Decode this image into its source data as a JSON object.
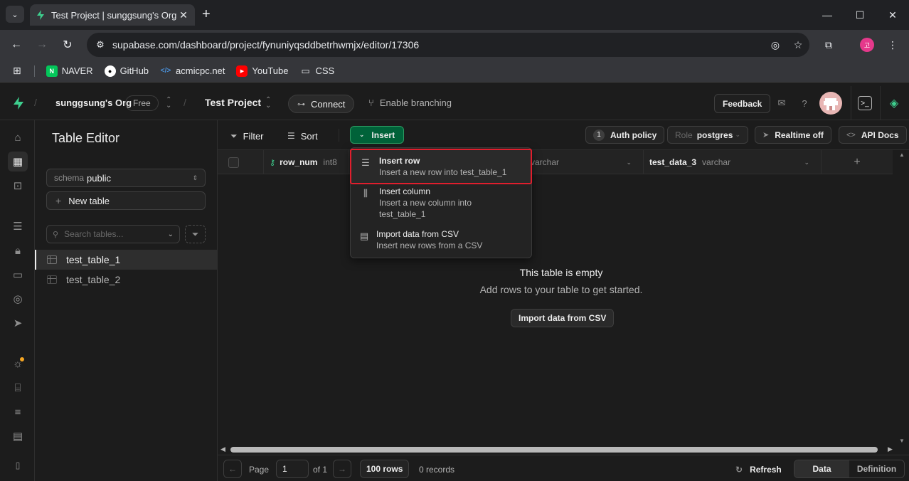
{
  "browser": {
    "tab_title": "Test Project | sunggsung's Org",
    "url": "supabase.com/dashboard/project/fynuniyqsddbetrhwmjx/editor/17306",
    "profile_initial": "고",
    "bookmarks": [
      "NAVER",
      "GitHub",
      "acmicpc.net",
      "YouTube",
      "CSS"
    ]
  },
  "appbar": {
    "org": "sunggsung's Org",
    "plan": "Free",
    "project": "Test Project",
    "connect": "Connect",
    "branching": "Enable branching",
    "feedback": "Feedback"
  },
  "sidebar": {
    "title": "Table Editor",
    "schema_label": "schema",
    "schema_value": "public",
    "new_table": "New table",
    "search_placeholder": "Search tables...",
    "tables": [
      "test_table_1",
      "test_table_2"
    ]
  },
  "toolbar": {
    "filter": "Filter",
    "sort": "Sort",
    "insert": "Insert",
    "auth_count": "1",
    "auth_policy": "Auth policy",
    "role_label": "Role",
    "role_value": "postgres",
    "realtime": "Realtime off",
    "api_docs": "API Docs"
  },
  "columns": [
    {
      "name": "row_num",
      "type": "int8"
    },
    {
      "name": "",
      "type": "varchar"
    },
    {
      "name": "test_data_3",
      "type": "varchar"
    }
  ],
  "insert_menu": [
    {
      "title": "Insert row",
      "desc": "Insert a new row into test_table_1"
    },
    {
      "title": "Insert column",
      "desc": "Insert a new column into test_table_1"
    },
    {
      "title": "Import data from CSV",
      "desc": "Insert new rows from a CSV"
    }
  ],
  "empty_state": {
    "title": "This table is empty",
    "subtitle": "Add rows to your table to get started.",
    "import_button": "Import data from CSV"
  },
  "footer": {
    "page_label": "Page",
    "page_value": "1",
    "of_pages": "of 1",
    "rows": "100 rows",
    "records": "0 records",
    "refresh": "Refresh",
    "data_tab": "Data",
    "definition_tab": "Definition"
  },
  "colors": {
    "accent_green": "#3ecf8e",
    "insert_bg": "#006239",
    "highlight_red": "#e01e2d"
  }
}
